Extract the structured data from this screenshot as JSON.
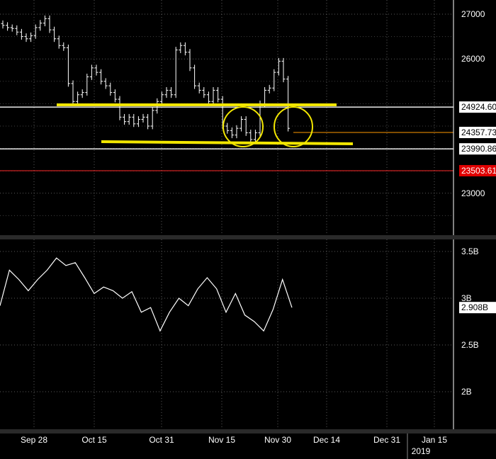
{
  "chart_data": [
    {
      "type": "ohlc",
      "ylim": [
        22200,
        27200
      ],
      "yticks": [
        23000,
        26000,
        27000
      ],
      "grid": true,
      "series": [
        {
          "values": [
            26750,
            26700,
            26680,
            26600,
            26500,
            26450,
            26520,
            26700,
            26800,
            26900,
            26650,
            26450,
            26300,
            26250,
            25450,
            25050,
            25200,
            25250,
            25600,
            25800,
            25700,
            25500,
            25400,
            25250,
            25100,
            24700,
            24600,
            24700,
            24550,
            24650,
            24700,
            24500,
            24850,
            25050,
            25200,
            25300,
            25200,
            26200,
            26300,
            26150,
            25800,
            25400,
            25300,
            25200,
            25050,
            25300,
            25100,
            24500,
            24400,
            24300,
            24450,
            24650,
            24350,
            24200,
            24350,
            25000,
            25300,
            25350,
            25700,
            25950,
            25550,
            24450
          ]
        }
      ],
      "reference_lines": [
        {
          "value": 24924.6,
          "label": "24924.60",
          "color": "#ffffff"
        },
        {
          "value": 24357.73,
          "label": "24357.73",
          "color": "#ff9900"
        },
        {
          "value": 23990.86,
          "label": "23990.86",
          "color": "#ffffff"
        },
        {
          "value": 23503.61,
          "label": "23503.61",
          "color": "#ff2a2a"
        }
      ]
    },
    {
      "type": "line",
      "ylim": [
        1.6,
        3.7
      ],
      "yticks": [
        {
          "value": 3.5,
          "label": "3.5B"
        },
        {
          "value": 3.0,
          "label": "3B"
        },
        {
          "value": 2.5,
          "label": "2.5B"
        },
        {
          "value": 2.0,
          "label": "2B"
        }
      ],
      "grid": true,
      "series": [
        {
          "values": [
            2.92,
            3.3,
            3.2,
            3.08,
            3.2,
            3.3,
            3.43,
            3.35,
            3.38,
            3.22,
            3.05,
            3.12,
            3.08,
            3.0,
            3.07,
            2.85,
            2.9,
            2.65,
            2.85,
            3.0,
            2.92,
            3.1,
            3.22,
            3.1,
            2.85,
            3.05,
            2.82,
            2.75,
            2.65,
            2.88,
            3.2,
            2.9
          ]
        }
      ],
      "last_value_label": "2.908B"
    }
  ],
  "x_axis": {
    "ticks": [
      "Sep 28",
      "Oct 15",
      "Oct 31",
      "Nov 15",
      "Nov 30",
      "Dec 14",
      "Dec 31",
      "Jan 15"
    ],
    "year_label": "2019"
  },
  "annotations": {
    "highlight_color": "#f2e600",
    "support_lines": [
      "upper",
      "lower"
    ],
    "circles": 2
  }
}
